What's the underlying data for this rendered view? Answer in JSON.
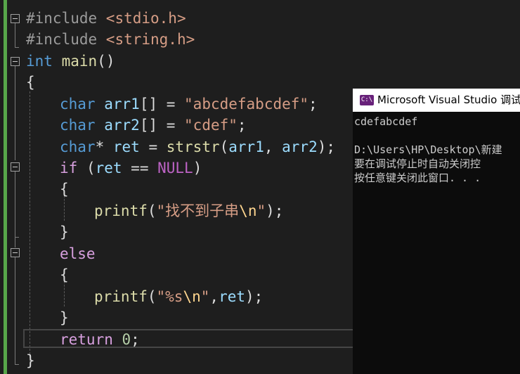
{
  "editor": {
    "lines": [
      {
        "p1": "#include ",
        "p2": "<stdio.h>"
      },
      {
        "p1": "#include ",
        "p2": "<string.h>"
      },
      {
        "kw": "int",
        "fn": "main",
        "rest": "()"
      },
      {
        "text": "{"
      },
      {
        "ty": "char",
        "var": "arr1",
        "mid": "[] = ",
        "str": "\"abcdefabcdef\"",
        "end": ";"
      },
      {
        "ty": "char",
        "var": "arr2",
        "mid": "[] = ",
        "str": "\"cdef\"",
        "end": ";"
      },
      {
        "ty": "char",
        "star": "* ",
        "var": "ret",
        "eq": " = ",
        "fn": "strstr",
        "a1": "arr1",
        "comma": ", ",
        "a2": "arr2",
        "end": ");"
      },
      {
        "ctl": "if",
        "open": " (",
        "var": "ret",
        "op": " == ",
        "mac": "NULL",
        "close": ")"
      },
      {
        "text": "{"
      },
      {
        "fn": "printf",
        "open": "(",
        "str": "\"找不到子串",
        "esc": "\\n",
        "strq": "\"",
        "end": ");"
      },
      {
        "text": "}"
      },
      {
        "ctl": "else"
      },
      {
        "text": "{"
      },
      {
        "fn": "printf",
        "open": "(",
        "str1": "\"%s",
        "esc": "\\n",
        "str2": "\"",
        "comma": ",",
        "var": "ret",
        "end": ");"
      },
      {
        "text": "}"
      },
      {
        "ctl": "return",
        "sp": " ",
        "num": "0",
        "end": ";"
      },
      {
        "text": "}"
      }
    ]
  },
  "console": {
    "title": "Microsoft Visual Studio 调试",
    "icon": "visual-studio-console-icon",
    "icon_text": "C:\\",
    "output": [
      "cdefabcdef",
      "",
      "D:\\Users\\HP\\Desktop\\新建",
      "要在调试停止时自动关闭控",
      "按任意键关闭此窗口. . ."
    ]
  },
  "colors": {
    "background": "#1e1e1e",
    "keyword": "#569cd6",
    "control": "#d8a0df",
    "function": "#dcdcaa",
    "variable": "#9cdcfe",
    "string": "#d69d85",
    "macro": "#bd63c5",
    "number": "#b5cea8",
    "change_bar": "#57a64a"
  }
}
